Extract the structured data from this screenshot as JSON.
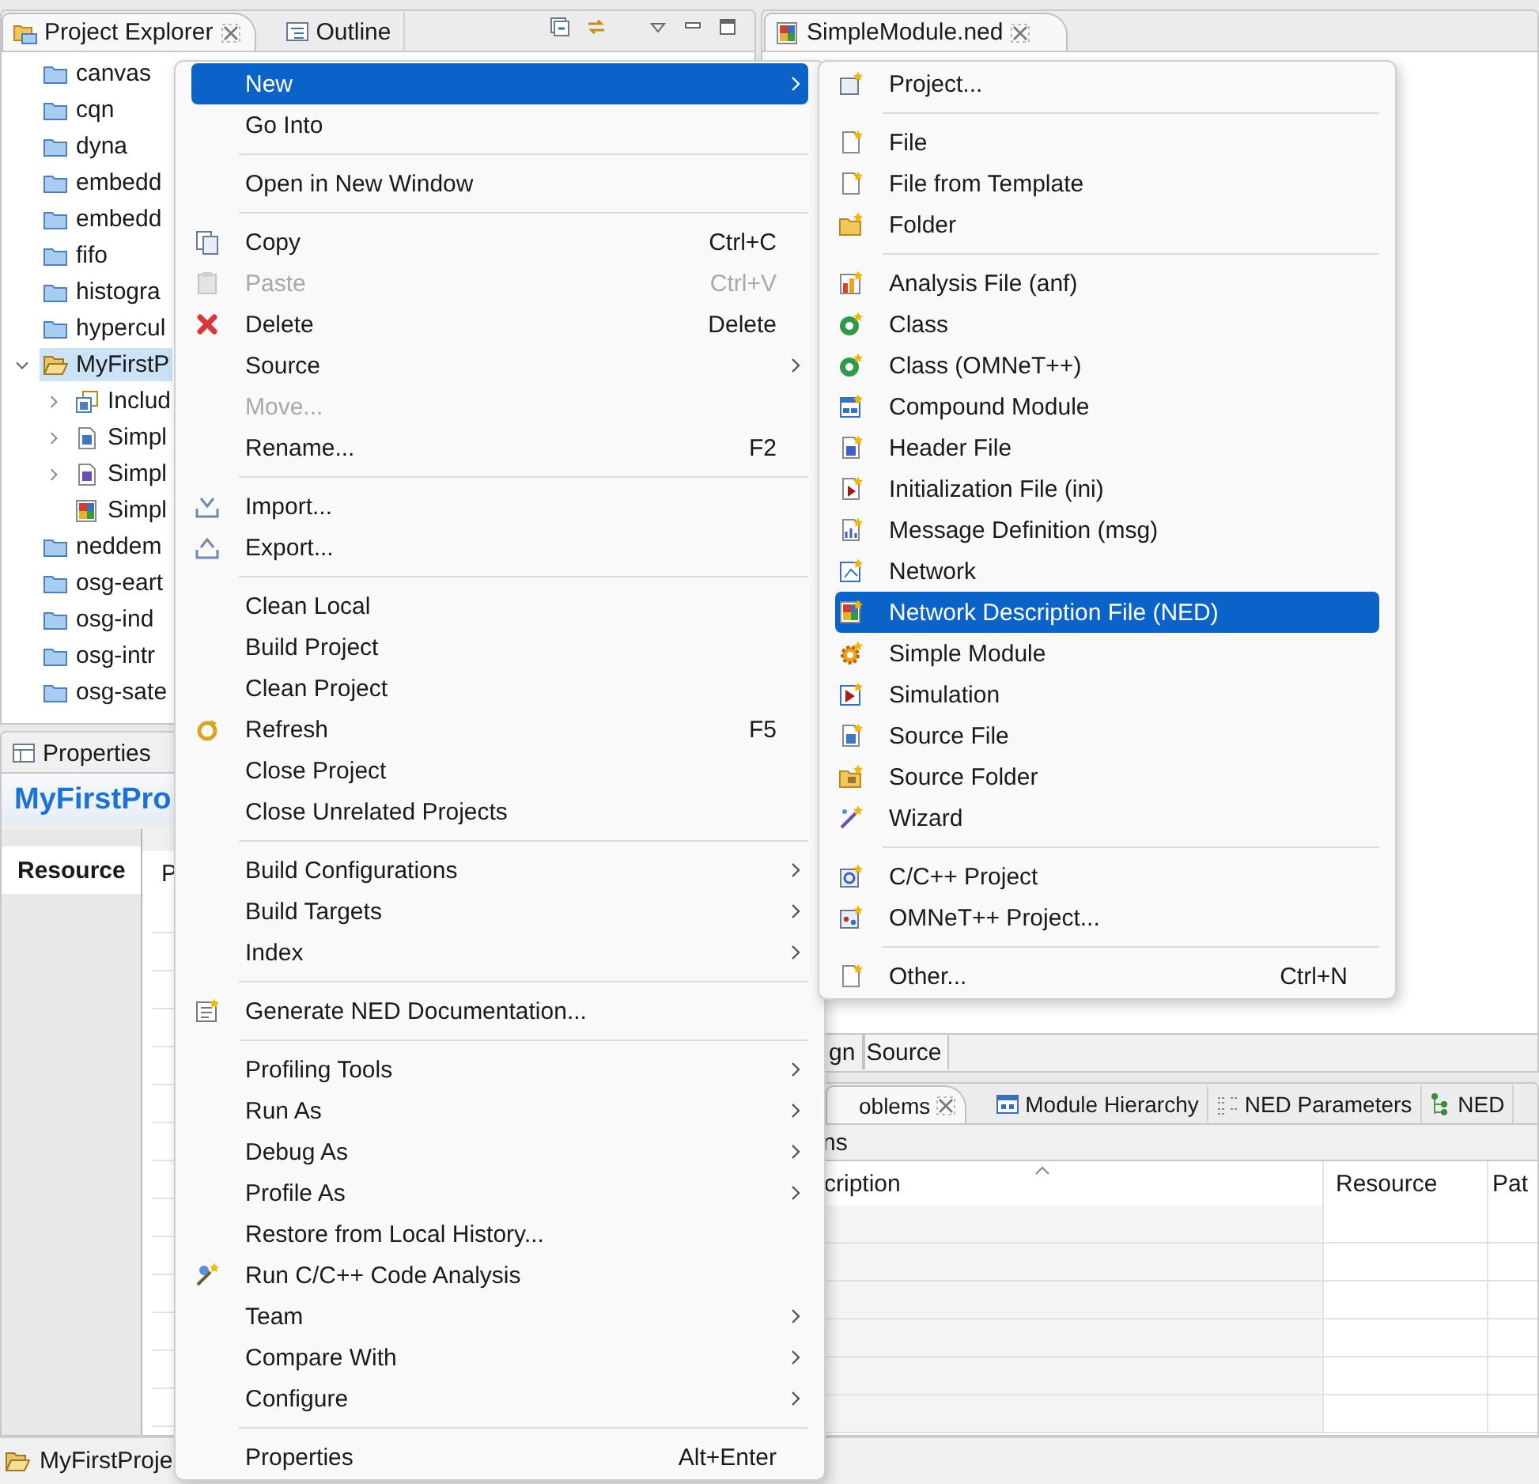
{
  "explorer": {
    "tabs": [
      {
        "label": "Project Explorer",
        "kind": "explorer",
        "selected": true,
        "closable": true
      },
      {
        "label": "Outline",
        "kind": "outline",
        "selected": false,
        "closable": false
      }
    ],
    "tree": [
      {
        "label": "canvas",
        "kind": "project",
        "selected": false
      },
      {
        "label": "cqn",
        "kind": "project",
        "selected": false
      },
      {
        "label": "dyna",
        "kind": "project",
        "selected": false
      },
      {
        "label": "embedd",
        "kind": "project",
        "selected": false
      },
      {
        "label": "embedd",
        "kind": "project",
        "selected": false
      },
      {
        "label": "fifo",
        "kind": "project",
        "selected": false
      },
      {
        "label": "histogra",
        "kind": "project",
        "selected": false
      },
      {
        "label": "hypercul",
        "kind": "project",
        "selected": false
      },
      {
        "label": "MyFirstP",
        "kind": "open-project",
        "selected": true,
        "expanded": true,
        "children": [
          {
            "label": "Includ",
            "kind": "includes",
            "selected": false,
            "expanded": false
          },
          {
            "label": "Simpl",
            "kind": "c-file",
            "selected": false,
            "expanded": false
          },
          {
            "label": "Simpl",
            "kind": "h-file",
            "selected": false,
            "expanded": false
          },
          {
            "label": "Simpl",
            "kind": "ned-file",
            "selected": false
          }
        ]
      },
      {
        "label": "neddem",
        "kind": "project",
        "selected": false
      },
      {
        "label": "osg-eart",
        "kind": "project",
        "selected": false
      },
      {
        "label": "osg-ind",
        "kind": "project",
        "selected": false
      },
      {
        "label": "osg-intr",
        "kind": "project",
        "selected": false
      },
      {
        "label": "osg-sate",
        "kind": "project",
        "selected": false
      }
    ]
  },
  "properties": {
    "tab_label": "Properties",
    "title": "MyFirstPro",
    "tabs": [
      {
        "label": "Resource",
        "selected": true
      }
    ],
    "table_header": "P"
  },
  "editor": {
    "tabs": [
      {
        "label": "SimpleModule.ned",
        "kind": "ned-file",
        "selected": true,
        "closable": true
      }
    ],
    "page_tabs": [
      {
        "label": "gn",
        "selected": false
      },
      {
        "label": "Source",
        "selected": true
      }
    ]
  },
  "problems": {
    "tabs": [
      {
        "label": "oblems",
        "kind": "plain",
        "selected": true,
        "closable": true
      },
      {
        "label": "Module Hierarchy",
        "kind": "hierarchy",
        "selected": false,
        "closable": false
      },
      {
        "label": "NED Parameters",
        "kind": "parameters",
        "selected": false,
        "closable": false
      },
      {
        "label": "NED",
        "kind": "ned-tree",
        "selected": false,
        "closable": false
      }
    ],
    "summary": "ns",
    "columns": [
      {
        "label": "cription",
        "sorted": true
      },
      {
        "label": "Resource",
        "sorted": false
      },
      {
        "label": "Pat",
        "sorted": false
      }
    ]
  },
  "status_bar": {
    "label": "MyFirstProje",
    "kind": "open-project"
  },
  "context_menu": {
    "groups": [
      [
        {
          "label": "New",
          "kind": "plain",
          "submenu": true,
          "disabled": false,
          "selected": true
        },
        {
          "label": "Go Into",
          "kind": "plain",
          "submenu": false,
          "disabled": false,
          "selected": false
        }
      ],
      [
        {
          "label": "Open in New Window",
          "kind": "plain",
          "submenu": false,
          "disabled": false,
          "selected": false
        }
      ],
      [
        {
          "label": "Copy",
          "kind": "copy",
          "shortcut": "Ctrl+C",
          "submenu": false,
          "disabled": false,
          "selected": false
        },
        {
          "label": "Paste",
          "kind": "paste",
          "shortcut": "Ctrl+V",
          "submenu": false,
          "disabled": true,
          "selected": false
        },
        {
          "label": "Delete",
          "kind": "delete",
          "shortcut": "Delete",
          "submenu": false,
          "disabled": false,
          "selected": false
        },
        {
          "label": "Source",
          "kind": "plain",
          "submenu": true,
          "disabled": false,
          "selected": false
        },
        {
          "label": "Move...",
          "kind": "plain",
          "submenu": false,
          "disabled": true,
          "selected": false
        },
        {
          "label": "Rename...",
          "kind": "plain",
          "shortcut": "F2",
          "submenu": false,
          "disabled": false,
          "selected": false
        }
      ],
      [
        {
          "label": "Import...",
          "kind": "import",
          "submenu": false,
          "disabled": false,
          "selected": false
        },
        {
          "label": "Export...",
          "kind": "export",
          "submenu": false,
          "disabled": false,
          "selected": false
        }
      ],
      [
        {
          "label": "Clean Local",
          "kind": "plain",
          "submenu": false,
          "disabled": false,
          "selected": false
        },
        {
          "label": "Build Project",
          "kind": "plain",
          "submenu": false,
          "disabled": false,
          "selected": false
        },
        {
          "label": "Clean Project",
          "kind": "plain",
          "submenu": false,
          "disabled": false,
          "selected": false
        },
        {
          "label": "Refresh",
          "kind": "refresh",
          "shortcut": "F5",
          "submenu": false,
          "disabled": false,
          "selected": false
        },
        {
          "label": "Close Project",
          "kind": "plain",
          "submenu": false,
          "disabled": false,
          "selected": false
        },
        {
          "label": "Close Unrelated Projects",
          "kind": "plain",
          "submenu": false,
          "disabled": false,
          "selected": false
        }
      ],
      [
        {
          "label": "Build Configurations",
          "kind": "plain",
          "submenu": true,
          "disabled": false,
          "selected": false
        },
        {
          "label": "Build Targets",
          "kind": "plain",
          "submenu": true,
          "disabled": false,
          "selected": false
        },
        {
          "label": "Index",
          "kind": "plain",
          "submenu": true,
          "disabled": false,
          "selected": false
        }
      ],
      [
        {
          "label": "Generate NED Documentation...",
          "kind": "gendoc",
          "submenu": false,
          "disabled": false,
          "selected": false
        }
      ],
      [
        {
          "label": "Profiling Tools",
          "kind": "plain",
          "submenu": true,
          "disabled": false,
          "selected": false
        },
        {
          "label": "Run As",
          "kind": "plain",
          "submenu": true,
          "disabled": false,
          "selected": false
        },
        {
          "label": "Debug As",
          "kind": "plain",
          "submenu": true,
          "disabled": false,
          "selected": false
        },
        {
          "label": "Profile As",
          "kind": "plain",
          "submenu": true,
          "disabled": false,
          "selected": false
        },
        {
          "label": "Restore from Local History...",
          "kind": "plain",
          "submenu": false,
          "disabled": false,
          "selected": false
        },
        {
          "label": "Run C/C++ Code Analysis",
          "kind": "code-analysis",
          "submenu": false,
          "disabled": false,
          "selected": false
        },
        {
          "label": "Team",
          "kind": "plain",
          "submenu": true,
          "disabled": false,
          "selected": false
        },
        {
          "label": "Compare With",
          "kind": "plain",
          "submenu": true,
          "disabled": false,
          "selected": false
        },
        {
          "label": "Configure",
          "kind": "plain",
          "submenu": true,
          "disabled": false,
          "selected": false
        }
      ],
      [
        {
          "label": "Properties",
          "kind": "plain",
          "shortcut": "Alt+Enter",
          "submenu": false,
          "disabled": false,
          "selected": false
        }
      ]
    ]
  },
  "new_submenu": {
    "groups": [
      [
        {
          "label": "Project...",
          "kind": "new-project",
          "submenu": false,
          "disabled": false,
          "selected": false
        }
      ],
      [
        {
          "label": "File",
          "kind": "new-file",
          "submenu": false,
          "disabled": false,
          "selected": false
        },
        {
          "label": "File from Template",
          "kind": "new-file",
          "submenu": false,
          "disabled": false,
          "selected": false
        },
        {
          "label": "Folder",
          "kind": "new-folder",
          "submenu": false,
          "disabled": false,
          "selected": false
        }
      ],
      [
        {
          "label": "Analysis File (anf)",
          "kind": "analysis-file",
          "submenu": false,
          "disabled": false,
          "selected": false
        },
        {
          "label": "Class",
          "kind": "class",
          "submenu": false,
          "disabled": false,
          "selected": false
        },
        {
          "label": "Class (OMNeT++)",
          "kind": "class",
          "submenu": false,
          "disabled": false,
          "selected": false
        },
        {
          "label": "Compound Module",
          "kind": "compound",
          "submenu": false,
          "disabled": false,
          "selected": false
        },
        {
          "label": "Header File",
          "kind": "header",
          "submenu": false,
          "disabled": false,
          "selected": false
        },
        {
          "label": "Initialization File (ini)",
          "kind": "ini",
          "submenu": false,
          "disabled": false,
          "selected": false
        },
        {
          "label": "Message Definition (msg)",
          "kind": "msg",
          "submenu": false,
          "disabled": false,
          "selected": false
        },
        {
          "label": "Network",
          "kind": "network",
          "submenu": false,
          "disabled": false,
          "selected": false
        },
        {
          "label": "Network Description File (NED)",
          "kind": "ned",
          "submenu": false,
          "disabled": false,
          "selected": true
        },
        {
          "label": "Simple Module",
          "kind": "simple-module",
          "submenu": false,
          "disabled": false,
          "selected": false
        },
        {
          "label": "Simulation",
          "kind": "simulation",
          "submenu": false,
          "disabled": false,
          "selected": false
        },
        {
          "label": "Source File",
          "kind": "source-file",
          "submenu": false,
          "disabled": false,
          "selected": false
        },
        {
          "label": "Source Folder",
          "kind": "source-folder",
          "submenu": false,
          "disabled": false,
          "selected": false
        },
        {
          "label": "Wizard",
          "kind": "wizard",
          "submenu": false,
          "disabled": false,
          "selected": false
        }
      ],
      [
        {
          "label": "C/C++ Project",
          "kind": "cpp-project",
          "submenu": false,
          "disabled": false,
          "selected": false
        },
        {
          "label": "OMNeT++ Project...",
          "kind": "omnet-project",
          "submenu": false,
          "disabled": false,
          "selected": false
        }
      ],
      [
        {
          "label": "Other...",
          "kind": "new-file",
          "shortcut": "Ctrl+N",
          "submenu": false,
          "disabled": false,
          "selected": false
        }
      ]
    ]
  }
}
